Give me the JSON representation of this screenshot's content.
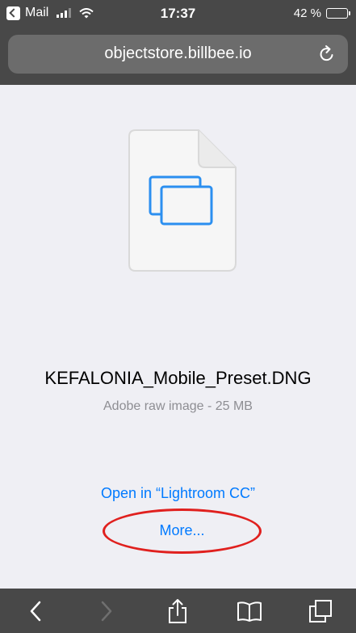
{
  "status_bar": {
    "back_app_label": "Mail",
    "time": "17:37",
    "battery_text": "42 %",
    "battery_level": 0.42
  },
  "browser": {
    "url": "objectstore.billbee.io",
    "reload_icon": "reload-icon"
  },
  "file": {
    "icon": "document-icon",
    "name": "KEFALONIA_Mobile_Preset.DNG",
    "type_info": "Adobe raw image - 25 MB"
  },
  "actions": {
    "open_in_label": "Open in “Lightroom CC”",
    "more_label": "More..."
  },
  "toolbar": {
    "items": [
      "back-icon",
      "forward-icon",
      "share-icon",
      "bookmarks-icon",
      "tabs-icon"
    ]
  },
  "colors": {
    "link": "#007aff",
    "highlight_oval": "#e0201e",
    "chrome": "#484848"
  }
}
